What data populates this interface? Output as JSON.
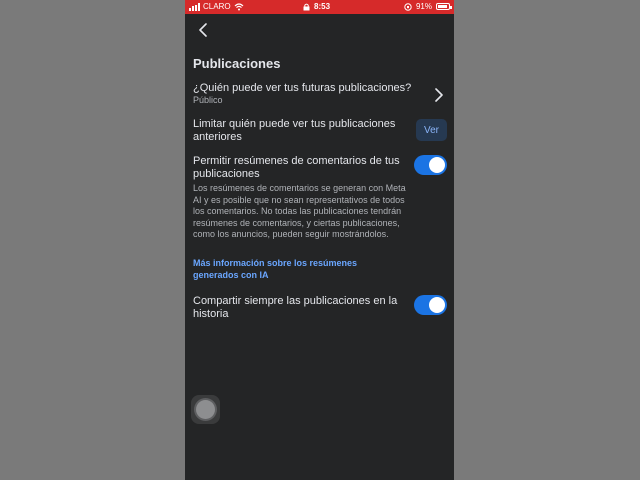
{
  "status_bar": {
    "carrier": "CLARO",
    "time": "8:53",
    "battery_percent": "91%",
    "battery_level": 0.91
  },
  "header": {
    "back_icon": "chevron-left-icon"
  },
  "section": {
    "title": "Publicaciones"
  },
  "settings": {
    "future_posts": {
      "title": "¿Quién puede ver tus futuras publicaciones?",
      "value": "Público"
    },
    "limit_past": {
      "title": "Limitar quién puede ver tus publicaciones anteriores",
      "button_label": "Ver"
    },
    "comment_summaries": {
      "title": "Permitir resúmenes de comentarios de tus publicaciones",
      "enabled": true,
      "description": "Los resúmenes de comentarios se generan con Meta AI y es posible que no sean representativos de todos los comentarios. No todas las publicaciones tendrán resúmenes de comentarios, y ciertas publicaciones, como los anuncios, pueden seguir mostrándolos.",
      "link": "Más información sobre los resúmenes generados con IA"
    },
    "share_to_story": {
      "title": "Compartir siempre las publicaciones en la historia",
      "enabled": true
    }
  },
  "colors": {
    "status_bar": "#d62a2a",
    "background": "#242526",
    "accent": "#1b74e4",
    "link": "#6aa6ff"
  }
}
